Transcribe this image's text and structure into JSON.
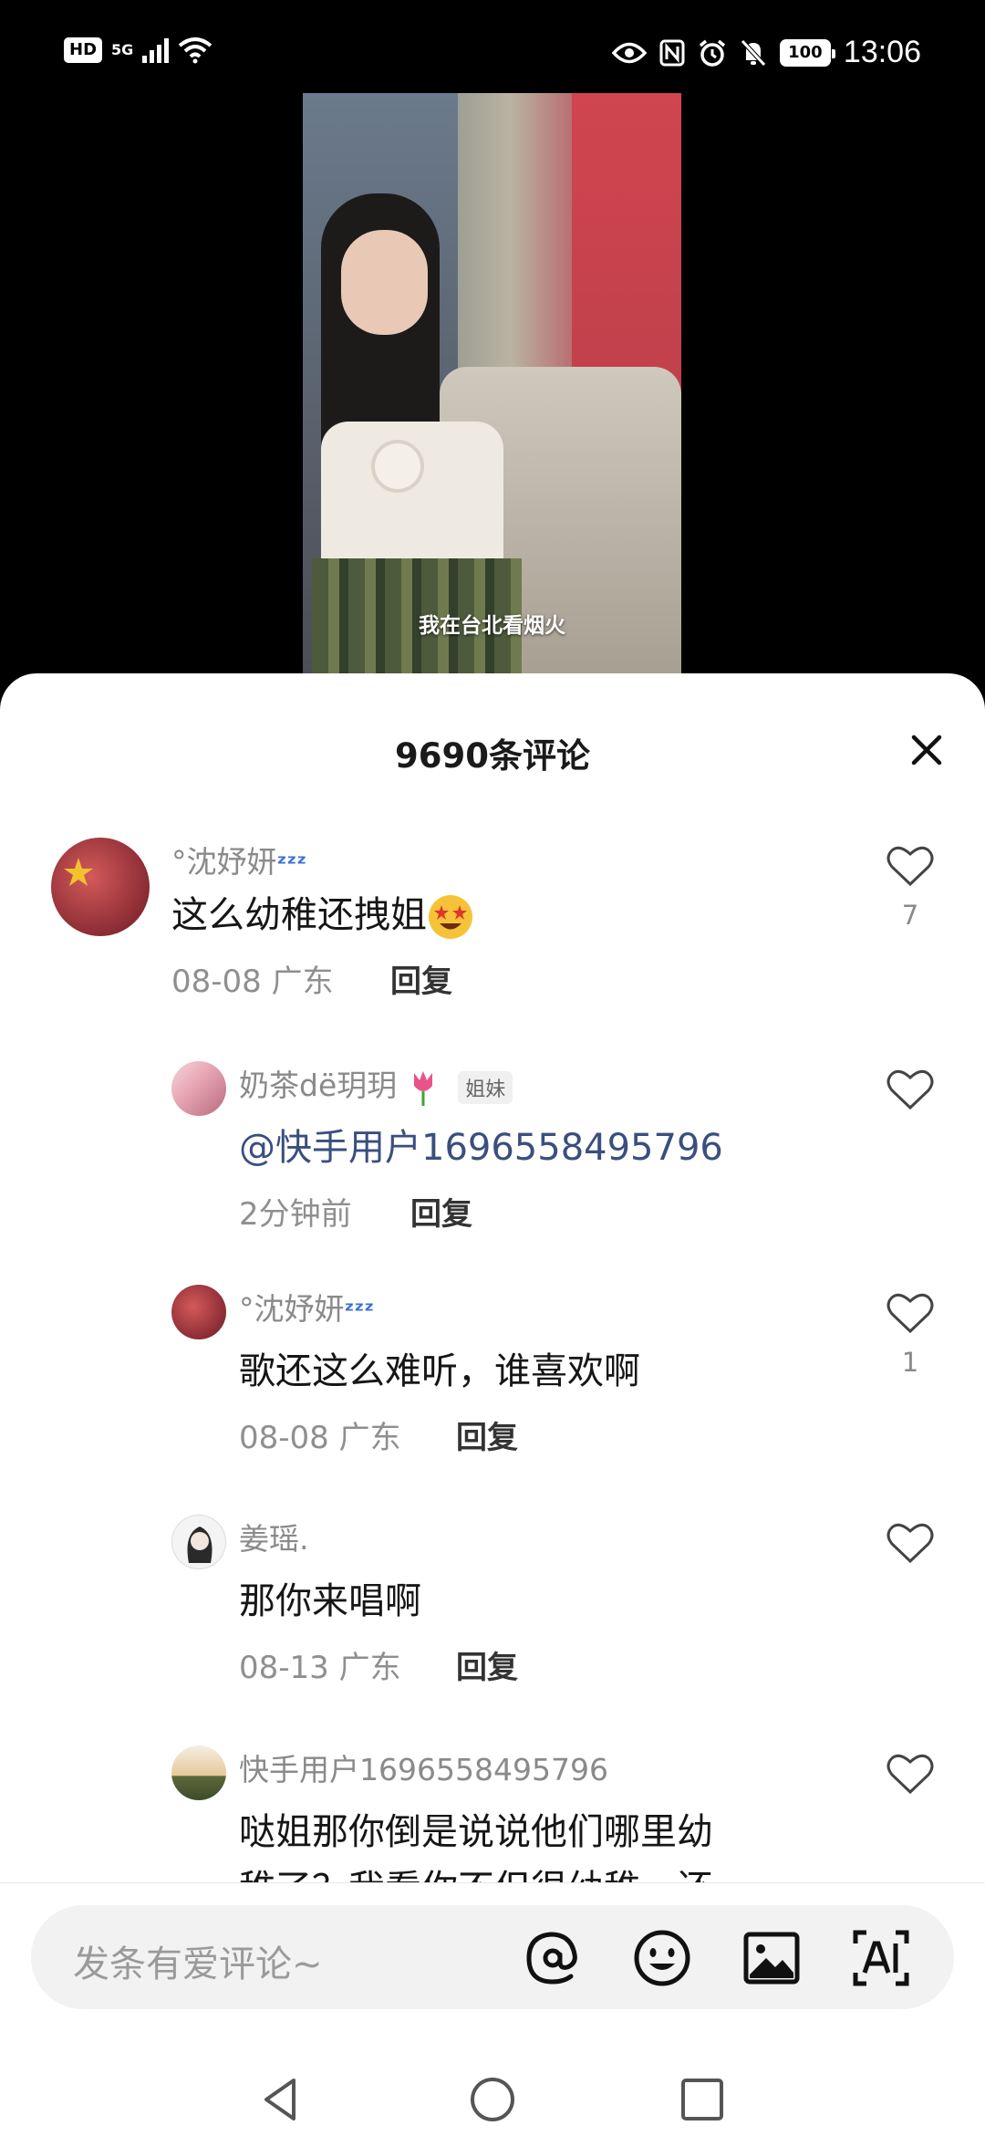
{
  "status_bar": {
    "left_badge": "HD",
    "network": "5G",
    "battery": "100",
    "time": "13:06"
  },
  "video": {
    "caption": "我在台北看烟火"
  },
  "sheet": {
    "title": "9690条评论"
  },
  "comments": [
    {
      "username": "°沈妤妍",
      "text": "这么幼稚还拽姐",
      "date": "08-08",
      "location": "广东",
      "reply_label": "回复",
      "likes": "7"
    },
    {
      "username": "奶茶dë玥玥",
      "tag": "姐妹",
      "text": "@快手用户1696558495796",
      "date": "2分钟前",
      "location": "",
      "reply_label": "回复",
      "likes": ""
    },
    {
      "username": "°沈妤妍",
      "text": "歌还这么难听，谁喜欢啊",
      "date": "08-08",
      "location": "广东",
      "reply_label": "回复",
      "likes": "1"
    },
    {
      "username": "姜瑶.",
      "text": "那你来唱啊",
      "date": "08-13",
      "location": "广东",
      "reply_label": "回复",
      "likes": ""
    },
    {
      "username": "快手用户1696558495796",
      "text": "哒姐那你倒是说说他们哪里幼",
      "text_line2": "稚了？我看你不但很幼稚，还",
      "likes": ""
    }
  ],
  "composer": {
    "placeholder": "发条有爱评论~",
    "tools": [
      "mention-icon",
      "emoji-icon",
      "image-icon",
      "ai-icon"
    ]
  },
  "colors": {
    "mention": "#3a4f7e",
    "meta": "#8f8f8f",
    "sheet_bg": "#ffffff"
  }
}
